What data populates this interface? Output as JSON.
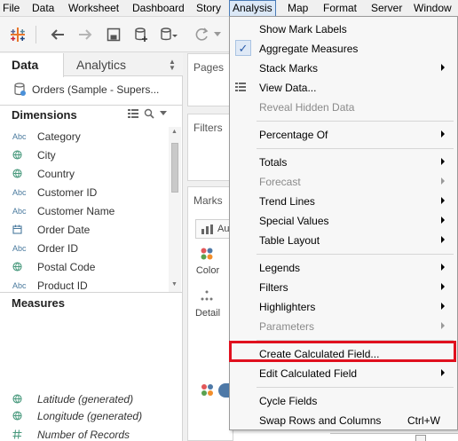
{
  "menubar": {
    "items": [
      "File",
      "Data",
      "Worksheet",
      "Dashboard",
      "Story",
      "Analysis",
      "Map",
      "Format",
      "Server",
      "Window"
    ],
    "active": "Analysis"
  },
  "toolbar": {
    "icons": [
      "tableau-logo-icon",
      "back-arrow-icon",
      "forward-arrow-icon",
      "save-icon",
      "new-datasource-icon",
      "datasource-icon",
      "refresh-icon"
    ]
  },
  "left_panel": {
    "tabs": {
      "data": "Data",
      "analytics": "Analytics"
    },
    "datasource": "Orders (Sample - Supers...",
    "dimensions_title": "Dimensions",
    "dimensions": [
      {
        "type": "Abc",
        "icon": "string-type-icon",
        "label": "Category"
      },
      {
        "type": "globe",
        "icon": "globe-icon",
        "label": "City"
      },
      {
        "type": "globe",
        "icon": "globe-icon",
        "label": "Country"
      },
      {
        "type": "Abc",
        "icon": "string-type-icon",
        "label": "Customer ID"
      },
      {
        "type": "Abc",
        "icon": "string-type-icon",
        "label": "Customer Name"
      },
      {
        "type": "date",
        "icon": "calendar-icon",
        "label": "Order Date"
      },
      {
        "type": "Abc",
        "icon": "string-type-icon",
        "label": "Order ID"
      },
      {
        "type": "globe",
        "icon": "globe-icon",
        "label": "Postal Code"
      },
      {
        "type": "Abc",
        "icon": "string-type-icon",
        "label": "Product ID"
      }
    ],
    "measures_title": "Measures",
    "measures": [
      {
        "icon": "globe-icon",
        "label": "Latitude (generated)"
      },
      {
        "icon": "globe-icon",
        "label": "Longitude (generated)"
      },
      {
        "icon": "number-icon",
        "label": "Number of Records"
      }
    ]
  },
  "shelves": {
    "pages": "Pages",
    "filters": "Filters",
    "marks": "Marks",
    "marks_type": "Au",
    "color": "Color",
    "detail": "Detail"
  },
  "analysis_menu": {
    "items": [
      {
        "label": "Show Mark Labels"
      },
      {
        "label": "Aggregate Measures",
        "checked": true
      },
      {
        "label": "Stack Marks",
        "submenu": true
      },
      {
        "label": "View Data...",
        "icon": "grid-icon"
      },
      {
        "label": "Reveal Hidden Data",
        "disabled": true
      },
      {
        "label": "Percentage Of",
        "submenu": true
      },
      {
        "label": "Totals",
        "submenu": true
      },
      {
        "label": "Forecast",
        "submenu": true,
        "disabled": true
      },
      {
        "label": "Trend Lines",
        "submenu": true
      },
      {
        "label": "Special Values",
        "submenu": true
      },
      {
        "label": "Table Layout",
        "submenu": true
      },
      {
        "label": "Legends",
        "submenu": true
      },
      {
        "label": "Filters",
        "submenu": true
      },
      {
        "label": "Highlighters",
        "submenu": true
      },
      {
        "label": "Parameters",
        "submenu": true,
        "disabled": true
      },
      {
        "label": "Create Calculated Field...",
        "highlighted": true
      },
      {
        "label": "Edit Calculated Field",
        "submenu": true
      },
      {
        "label": "Cycle Fields"
      },
      {
        "label": "Swap Rows and Columns",
        "shortcut": "Ctrl+W"
      }
    ]
  },
  "colors": {
    "highlight_border": "#e0101e",
    "check_blue": "#2a5caa",
    "menu_bg": "#f7f7f7",
    "active_menu_bg": "#dbe8f7"
  }
}
